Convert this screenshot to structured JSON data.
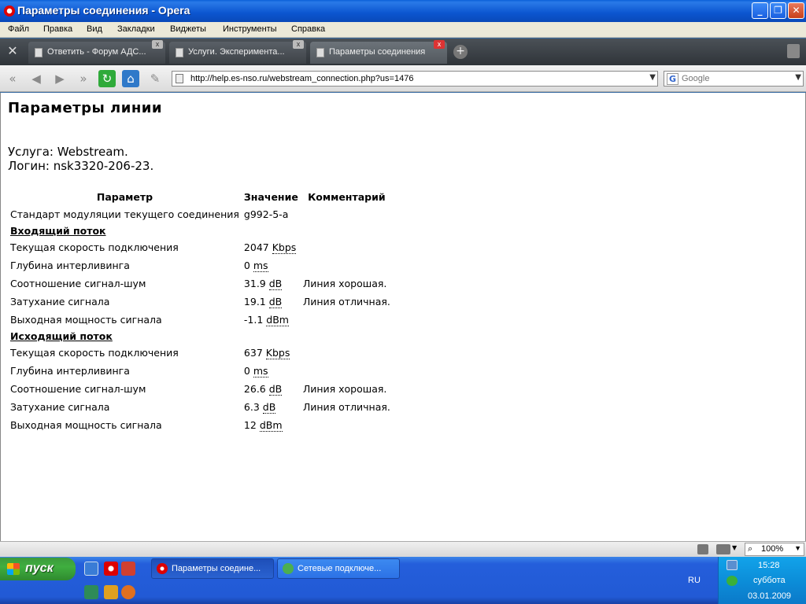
{
  "window": {
    "title": "Параметры соединения - Opera",
    "min_label": "_",
    "max_label": "❐",
    "close_label": "✕"
  },
  "menu": [
    "Файл",
    "Правка",
    "Вид",
    "Закладки",
    "Виджеты",
    "Инструменты",
    "Справка"
  ],
  "tabs": [
    {
      "label": "Ответить - Форум АДС...",
      "active": false
    },
    {
      "label": "Услуги. Эксперимента...",
      "active": false
    },
    {
      "label": "Параметры соединения",
      "active": true
    }
  ],
  "tab_close_label": "x",
  "new_tab_label": "+",
  "address": {
    "url": "http://help.es-nso.ru/webstream_connection.php?us=1476"
  },
  "search": {
    "placeholder": "Google",
    "engine_letter": "G"
  },
  "page": {
    "heading": "Параметры линии",
    "service": "Услуга: Webstream.",
    "login": "Логин: nsk3320-206-23.",
    "columns": [
      "Параметр",
      "Значение",
      "Комментарий"
    ],
    "modulation": {
      "param": "Стандарт модуляции текущего соединения",
      "value": "g992-5-a"
    },
    "downstream": {
      "title": "Входящий поток",
      "rows": [
        {
          "param": "Текущая скорость подключения",
          "value": "2047",
          "unit": "Kbps",
          "comment": ""
        },
        {
          "param": "Глубина интерливинга",
          "value": "0",
          "unit": "ms",
          "comment": ""
        },
        {
          "param": "Соотношение сигнал-шум",
          "value": "31.9",
          "unit": "dB",
          "comment": "Линия хорошая."
        },
        {
          "param": "Затухание сигнала",
          "value": "19.1",
          "unit": "dB",
          "comment": "Линия отличная."
        },
        {
          "param": "Выходная мощность сигнала",
          "value": "-1.1",
          "unit": "dBm",
          "comment": ""
        }
      ]
    },
    "upstream": {
      "title": "Исходящий поток",
      "rows": [
        {
          "param": "Текущая скорость подключения",
          "value": "637",
          "unit": "Kbps",
          "comment": ""
        },
        {
          "param": "Глубина интерливинга",
          "value": "0",
          "unit": "ms",
          "comment": ""
        },
        {
          "param": "Соотношение сигнал-шум",
          "value": "26.6",
          "unit": "dB",
          "comment": "Линия хорошая."
        },
        {
          "param": "Затухание сигнала",
          "value": "6.3",
          "unit": "dB",
          "comment": "Линия отличная."
        },
        {
          "param": "Выходная мощность сигнала",
          "value": "12",
          "unit": "dBm",
          "comment": ""
        }
      ]
    }
  },
  "statusbar": {
    "zoom": "100%"
  },
  "taskbar": {
    "start_label": "пуск",
    "tasks": [
      {
        "label": "Параметры соедине...",
        "active": true
      },
      {
        "label": "Сетевые подключе...",
        "active": false
      }
    ],
    "language": "RU",
    "time": "15:28",
    "day": "суббота",
    "date": "03.01.2009"
  },
  "colors": {
    "titlebar": "#0b55d0",
    "tabbar": "#3d4247",
    "start_green": "#3fae3f",
    "tray_blue": "#0c8ed9"
  }
}
